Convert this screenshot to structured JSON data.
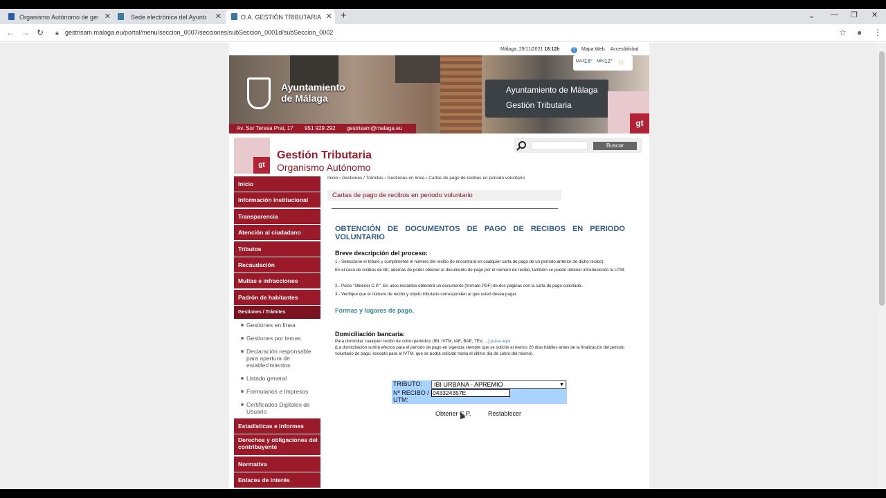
{
  "browser": {
    "tabs": [
      {
        "title": "Organismo Autónomo de gestió",
        "favicon_color": "#2a5ca8"
      },
      {
        "title": "Sede electrónica del Ayuntamien",
        "favicon_color": "#3b7a9e"
      },
      {
        "title": "O.A. GESTIÓN TRIBUTARIA",
        "favicon_color": "#3b7a9e"
      }
    ],
    "url": "gestrisam.malaga.eu/portal/menu/seccion_0007/secciones/subSeccion_0001d/subSeccion_0002"
  },
  "header": {
    "location_date": "Málaga, 29/11/2021",
    "time": "18:12h",
    "links": [
      "Mapa Web",
      "Accesibilidad"
    ],
    "weather": {
      "max_label": "MAX",
      "max": "18°",
      "min_label": "MIN",
      "min": "12°"
    },
    "banner_title_line1": "Ayuntamiento",
    "banner_title_line2": "de Málaga",
    "plaque_line1": "Ayuntamiento de Málaga",
    "plaque_line2": "Gestión Tributaria",
    "gt_logo_text": "gt",
    "address": "Av. Sor Teresa Prat, 17",
    "phone": "951 929 292",
    "email": "gestrisam@malaga.eu"
  },
  "brand": {
    "title": "Gestión Tributaria",
    "subtitle": "Organismo Autónomo",
    "logo_text": "gt"
  },
  "search": {
    "placeholder": "",
    "button_label": "Buscar"
  },
  "menu": {
    "top_items": [
      "Inicio",
      "Información institucional",
      "Transparencia",
      "Atención al ciudadano",
      "Tributos",
      "Recaudación",
      "Multas e infracciones",
      "Padrón de habitantes"
    ],
    "active_section": "Gestiones / Trámites",
    "sub_items": [
      "Gestiones en línea",
      "Gestiones por temas",
      "Declaración responsable para apertura de establecimientos",
      "Listado general",
      "Formularios e Impresos",
      "Certificados Digitales de Usuario"
    ],
    "bottom_items": [
      "Estadísticas e informes",
      "Derechos y obligaciones del contribuyente",
      "Normativa",
      "Enlaces de interés"
    ]
  },
  "content": {
    "breadcrumb": "Inicio › Gestiones / Trámites › Gestiones en línea › Cartas de pago de recibos en periodo voluntario",
    "title": "Cartas de pago de recibos en periodo voluntario",
    "heading_line1": "OBTENCIÓN DE DOCUMENTOS DE PAGO DE RECIBOS EN PERIODO",
    "heading_line2": "VOLUNTARIO",
    "process_title": "Breve descripción del proceso:",
    "steps": [
      "1.- Seleccione el tributo y cumplimente el número del recibo (lo encontrará en cualquier carta de pago de un período anterior de dicho recibo).",
      "En el caso de recibos de IBI, además de poder obtener el documento de pago por el número de recibo, también se puede obtener introduciendo la UTM.",
      "2.- Pulse \"Obtener C.P.\". En unos instantes obtendrá un documento (formato PDF) de dos páginas con la carta de pago solicitada.",
      "3.- Verifique que el número de recibo y objeto tributario corresponden al que usted desea pagar."
    ],
    "formas_link": "Formas y lugares de pago.",
    "domi_title": "Domiciliación bancaria:",
    "domi_text1": "Para domiciliar cualquier recibo de cobro periódico (IBI, IVTM, IAE, BAE, TEV, ...)",
    "domi_link": "pulse aquí",
    "domi_text2": "(La domiciliación surtirá efectos para el periodo de pago en vigencia siempre que se solicite al menos 20 días hábiles antes de la finalización del periodo voluntario de pago, excepto para el IVTM, que se podrá solicitar hasta el último día de cobro del mismo)."
  },
  "form": {
    "tributo_label": "TRIBUTO:",
    "tributo_value": "IBI URBANA - APREMIO",
    "recibo_label": "Nº RECIBO / UTM:",
    "recibo_value": "043324357E",
    "obtener_label": "Obtener C.P.",
    "restablecer_label": "Restablecer"
  }
}
